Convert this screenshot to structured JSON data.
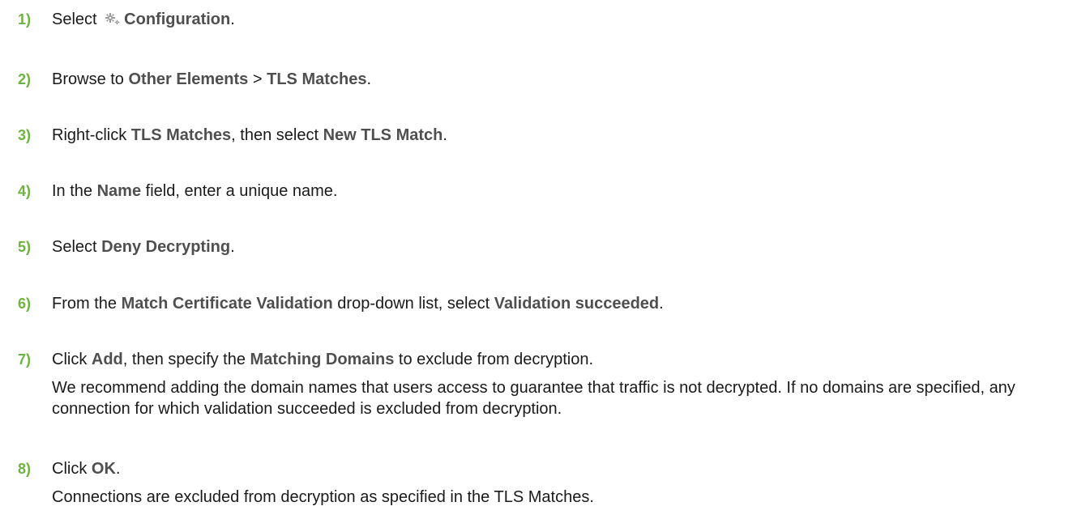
{
  "steps": [
    {
      "number": "1)",
      "parts": [
        "Select ",
        "Configuration",
        "."
      ],
      "icon": "gear-icon"
    },
    {
      "number": "2)",
      "parts": [
        "Browse to ",
        "Other Elements",
        " > ",
        "TLS Matches",
        "."
      ]
    },
    {
      "number": "3)",
      "parts": [
        "Right-click ",
        "TLS Matches",
        ", then select ",
        "New TLS Match",
        "."
      ]
    },
    {
      "number": "4)",
      "parts": [
        "In the ",
        "Name",
        " field, enter a unique name."
      ]
    },
    {
      "number": "5)",
      "parts": [
        "Select ",
        "Deny Decrypting",
        "."
      ]
    },
    {
      "number": "6)",
      "parts": [
        "From the ",
        "Match Certificate Validation",
        " drop-down list, select ",
        "Validation succeeded",
        "."
      ]
    },
    {
      "number": "7)",
      "parts": [
        "Click ",
        "Add",
        ", then specify the ",
        "Matching Domains",
        " to exclude from decryption."
      ],
      "note": "We recommend adding the domain names that users access to guarantee that traffic is not decrypted. If no domains are specified, any connection for which validation succeeded is excluded from decryption."
    },
    {
      "number": "8)",
      "parts": [
        "Click ",
        "OK",
        "."
      ],
      "note": "Connections are excluded from decryption as specified in the TLS Matches."
    }
  ],
  "colors": {
    "step_number": "#6db33f",
    "ui_term": "#4f4f4f",
    "body_text": "#1a1a1a"
  }
}
